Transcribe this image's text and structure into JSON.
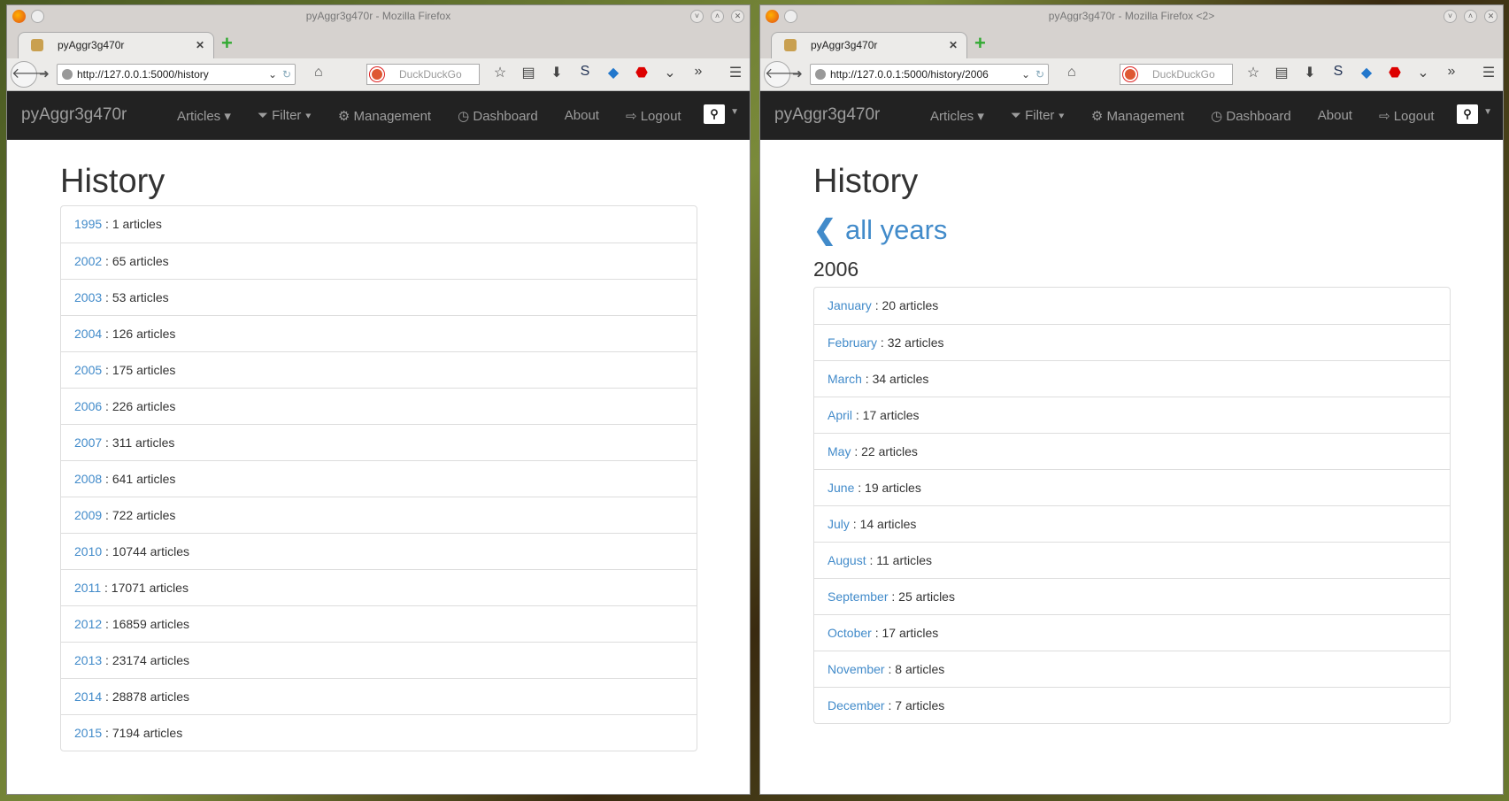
{
  "windows": [
    {
      "title": "pyAggr3g470r - Mozilla Firefox",
      "tab": "pyAggr3g470r",
      "url": "http://127.0.0.1:5000/history"
    },
    {
      "title": "pyAggr3g470r - Mozilla Firefox <2>",
      "tab": "pyAggr3g470r",
      "url": "http://127.0.0.1:5000/history/2006"
    }
  ],
  "browser": {
    "search_placeholder": "DuckDuckGo"
  },
  "navbar": {
    "brand": "pyAggr3g470r",
    "items": [
      "Articles",
      "Filter",
      "Management",
      "Dashboard",
      "About",
      "Logout"
    ]
  },
  "left": {
    "heading": "History",
    "rows": [
      {
        "link": "1995",
        "text": " : 1 articles"
      },
      {
        "link": "2002",
        "text": " : 65 articles"
      },
      {
        "link": "2003",
        "text": " : 53 articles"
      },
      {
        "link": "2004",
        "text": " : 126 articles"
      },
      {
        "link": "2005",
        "text": " : 175 articles"
      },
      {
        "link": "2006",
        "text": " : 226 articles"
      },
      {
        "link": "2007",
        "text": " : 311 articles"
      },
      {
        "link": "2008",
        "text": " : 641 articles"
      },
      {
        "link": "2009",
        "text": " : 722 articles"
      },
      {
        "link": "2010",
        "text": " : 10744 articles"
      },
      {
        "link": "2011",
        "text": " : 17071 articles"
      },
      {
        "link": "2012",
        "text": " : 16859 articles"
      },
      {
        "link": "2013",
        "text": " : 23174 articles"
      },
      {
        "link": "2014",
        "text": " : 28878 articles"
      },
      {
        "link": "2015",
        "text": " : 7194 articles"
      }
    ]
  },
  "right": {
    "heading": "History",
    "back": "all years",
    "year": "2006",
    "rows": [
      {
        "link": "January",
        "text": " : 20 articles"
      },
      {
        "link": "February",
        "text": " : 32 articles"
      },
      {
        "link": "March",
        "text": " : 34 articles"
      },
      {
        "link": "April",
        "text": " : 17 articles"
      },
      {
        "link": "May",
        "text": " : 22 articles"
      },
      {
        "link": "June",
        "text": " : 19 articles"
      },
      {
        "link": "July",
        "text": " : 14 articles"
      },
      {
        "link": "August",
        "text": " : 11 articles"
      },
      {
        "link": "September",
        "text": " : 25 articles"
      },
      {
        "link": "October",
        "text": " : 17 articles"
      },
      {
        "link": "November",
        "text": " : 8 articles"
      },
      {
        "link": "December",
        "text": " : 7 articles"
      }
    ]
  },
  "colors": {
    "link": "#428bca",
    "navbar": "#222222"
  }
}
